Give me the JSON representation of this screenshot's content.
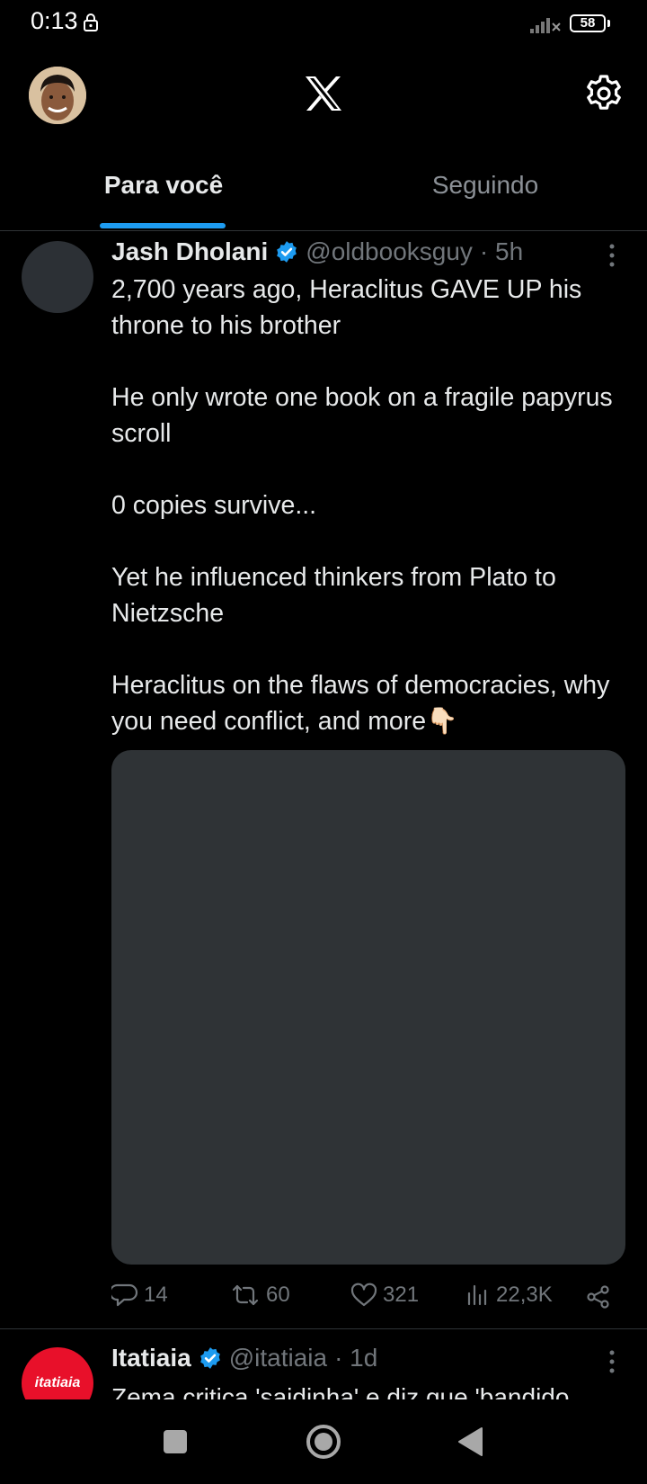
{
  "status_bar": {
    "time": "0:13",
    "battery": "58"
  },
  "header": {
    "logo": "x-logo",
    "settings_icon": "gear-icon"
  },
  "tabs": [
    {
      "label": "Para você",
      "active": true
    },
    {
      "label": "Seguindo",
      "active": false
    }
  ],
  "tweets": [
    {
      "name": "Jash Dholani",
      "verified": true,
      "handle": "@oldbooksguy",
      "time": "· 5h",
      "body": [
        "2,700 years ago, Heraclitus GAVE UP his throne to his brother",
        "He only wrote one book on a fragile papyrus scroll",
        "0 copies survive...",
        "Yet he influenced thinkers from Plato to Nietzsche",
        "Heraclitus on the flaws of democracies, why you need conflict, and more👇🏻"
      ],
      "replies": "14",
      "retweets": "60",
      "likes": "321",
      "views": "22,3K"
    },
    {
      "name": "Itatiaia",
      "verified": true,
      "handle": "@itatiaia",
      "time": "· 1d",
      "avatar_text": "itatiaia",
      "body_preview": "Zema critica 'saidinha' e diz que 'bandido"
    }
  ],
  "colors": {
    "accent": "#1d9bf0",
    "background": "#000000",
    "muted": "#71767b",
    "brand_itatiaia": "#e8102a"
  }
}
